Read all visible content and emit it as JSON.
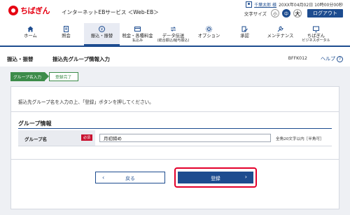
{
  "header": {
    "logo_text": "ちばぎん",
    "service_name": "インターネットEBサービス ＜Web-EB＞",
    "user_name": "千葉太郎 様",
    "login_time": "20XX年04月02日 10時00分00秒",
    "font_size_label": "文字サイズ",
    "font_small": "小",
    "font_medium": "中",
    "font_large": "大",
    "logout_label": "ログアウト"
  },
  "nav": {
    "items": [
      {
        "label": "ホーム",
        "sub": "",
        "icon": "home-icon"
      },
      {
        "label": "照会",
        "sub": "",
        "icon": "document-icon"
      },
      {
        "label": "振込・振替",
        "sub": "",
        "icon": "transfer-icon"
      },
      {
        "label": "税金・各種料金",
        "sub": "払込み",
        "icon": "tax-payment-icon"
      },
      {
        "label": "データ伝送",
        "sub": "(総合振込/給与振込)",
        "icon": "data-transfer-icon"
      },
      {
        "label": "オプション",
        "sub": "",
        "icon": "option-icon"
      },
      {
        "label": "承認",
        "sub": "",
        "icon": "approval-icon"
      },
      {
        "label": "メンテナンス",
        "sub": "",
        "icon": "maintenance-icon"
      },
      {
        "label": "ちばぎん",
        "sub": "ビジネスポータル",
        "icon": "portal-icon"
      }
    ],
    "active_index": 2
  },
  "title_bar": {
    "category": "振込・振替",
    "page_title": "振込先グループ情報入力",
    "screen_id": "BFFK012",
    "help_label": "ヘルプ"
  },
  "steps": [
    {
      "label": "グループ名入力"
    },
    {
      "label": "登録完了"
    }
  ],
  "panel": {
    "instruction": "振込先グループ名を入力の上、「登録」ボタンを押してください。",
    "section_title": "グループ情報",
    "group_name_label": "グループ名",
    "required_label": "必須",
    "group_name_value": "月初締め",
    "input_hint": "全角20文字以内［半角可］"
  },
  "buttons": {
    "back_label": "戻る",
    "register_label": "登録"
  },
  "colors": {
    "brand_red": "#e60012",
    "primary_blue": "#1d4c8f",
    "step_green": "#3d8c4a",
    "highlight_red": "#e3002b"
  }
}
